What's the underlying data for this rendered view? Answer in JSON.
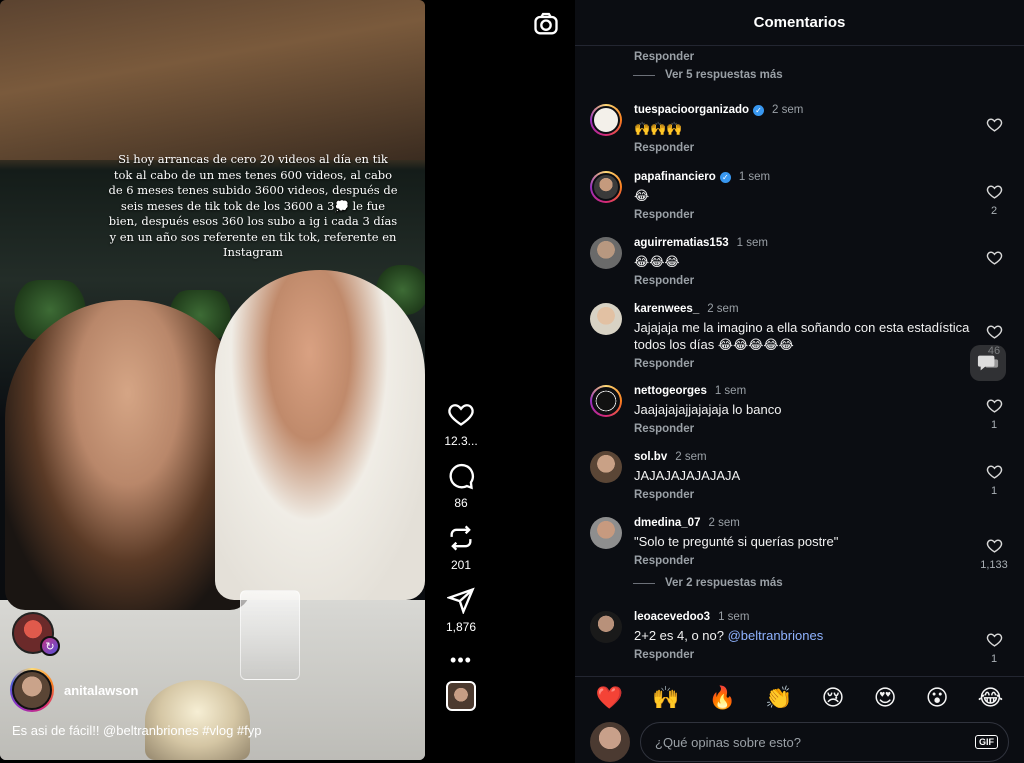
{
  "video": {
    "overlay_text": "Si hoy arrancas de cero 20 videos al día en tik tok al cabo de un mes tenes 600 videos, al cabo de 6 meses tenes subido 3600 videos, después de seis meses de tik tok de los 3600 a 3💭 le fue bien, después esos 360 los subo a ig i cada 3 días y en un año sos referente en tik tok, referente en Instagram",
    "author": "anitalawson",
    "caption": "Es asi de fácil!! @beltranbriones #vlog #fyp"
  },
  "actions": {
    "likes": "12.3...",
    "comments": "86",
    "reposts": "201",
    "shares": "1,876",
    "more": "•••"
  },
  "panel": {
    "title": "Comentarios",
    "top_reply_label": "Responder",
    "top_more_replies": "Ver 5 respuestas más",
    "comments": [
      {
        "user": "tuespacioorganizado",
        "verified": true,
        "time": "2 sem",
        "text": "🙌🙌🙌",
        "reply": "Responder",
        "likes": ""
      },
      {
        "user": "papafinanciero",
        "verified": true,
        "time": "1 sem",
        "text": "😂",
        "reply": "Responder",
        "likes": "2"
      },
      {
        "user": "aguirrematias153",
        "verified": false,
        "time": "1 sem",
        "text": "😂😂😂",
        "reply": "Responder",
        "likes": ""
      },
      {
        "user": "karenwees_",
        "verified": false,
        "time": "2 sem",
        "text": "Jajajaja me la imagino a ella soñando con esta estadística todos los días 😂😂😂😂😂",
        "reply": "Responder",
        "likes": "46"
      },
      {
        "user": "nettogeorges",
        "verified": false,
        "time": "1 sem",
        "text": "Jaajajajajjajajaja lo banco",
        "reply": "Responder",
        "likes": "1"
      },
      {
        "user": "sol.bv",
        "verified": false,
        "time": "2 sem",
        "text": "JAJAJAJAJAJAJA",
        "reply": "Responder",
        "likes": "1"
      },
      {
        "user": "dmedina_07",
        "verified": false,
        "time": "2 sem",
        "text": "\"Solo te pregunté si querías postre\"",
        "reply": "Responder",
        "likes": "1,133"
      },
      {
        "user": "leoacevedoo3",
        "verified": false,
        "time": "1 sem",
        "text": "2+2 es 4, o no? @beltranbriones",
        "reply": "Responder",
        "likes": "1"
      }
    ],
    "more_replies_2": "Ver 2 respuestas más",
    "emojis": [
      "❤️",
      "🙌",
      "🔥",
      "👏",
      "😢",
      "😍",
      "😮",
      "😂"
    ],
    "input_placeholder": "¿Qué opinas sobre esto?",
    "gif_label": "GIF"
  }
}
